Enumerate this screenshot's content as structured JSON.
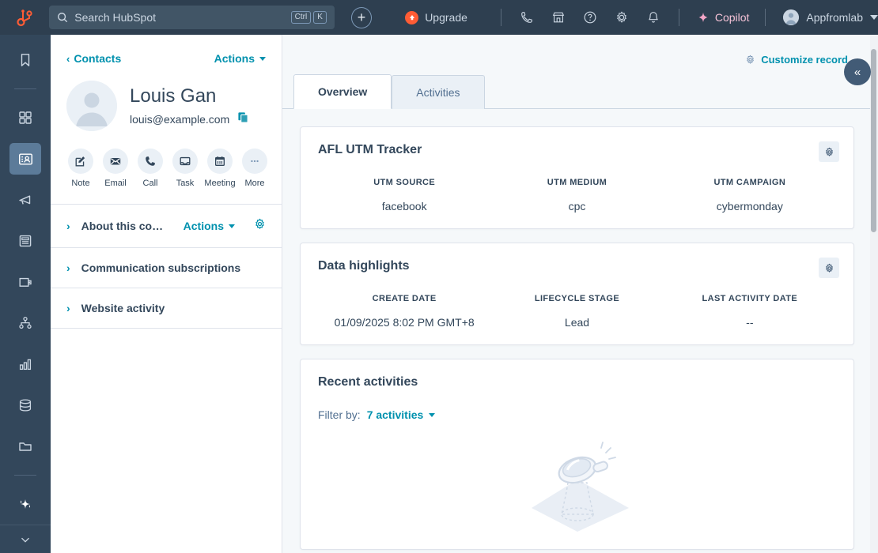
{
  "topnav": {
    "logo_icon": "hubspot-sprocket-logo",
    "search": {
      "placeholder": "Search HubSpot",
      "shortcut_modifier": "Ctrl",
      "shortcut_key": "K",
      "icon": "search-icon"
    },
    "create_button_label": "+",
    "upgrade_label": "Upgrade",
    "icons": [
      "phone-icon",
      "marketplace-icon",
      "help-circle-icon",
      "settings-gear-icon",
      "notifications-bell-icon"
    ],
    "copilot_label": "Copilot",
    "copilot_icon": "sparkle-icon",
    "account_name": "Appfromlab",
    "account_avatar": "user-avatar-icon"
  },
  "rail": {
    "items": [
      {
        "name": "bookmarks",
        "icon": "bookmark-icon",
        "active": false
      },
      {
        "name": "workspaces",
        "icon": "grid-icon",
        "active": false
      },
      {
        "name": "crm-contacts",
        "icon": "contacts-card-icon",
        "active": true
      },
      {
        "name": "marketing",
        "icon": "megaphone-icon",
        "active": false
      },
      {
        "name": "content",
        "icon": "content-page-icon",
        "active": false
      },
      {
        "name": "commerce",
        "icon": "wallet-icon",
        "active": false
      },
      {
        "name": "automation",
        "icon": "workflow-nodes-icon",
        "active": false
      },
      {
        "name": "reporting",
        "icon": "bar-chart-icon",
        "active": false
      },
      {
        "name": "data-management",
        "icon": "database-icon",
        "active": false
      },
      {
        "name": "library",
        "icon": "folder-icon",
        "active": false
      },
      {
        "name": "ai-assistant",
        "icon": "ai-sparkle-icon",
        "active": false
      }
    ],
    "expand_icon": "chevron-down-icon"
  },
  "left_panel": {
    "breadcrumb_label": "Contacts",
    "breadcrumb_icon": "chevron-left-icon",
    "actions_label": "Actions",
    "contact_name": "Louis Gan",
    "contact_email": "louis@example.com",
    "copy_icon": "copy-icon",
    "quick_actions": [
      {
        "label": "Note",
        "icon": "note-pencil-icon"
      },
      {
        "label": "Email",
        "icon": "envelope-icon"
      },
      {
        "label": "Call",
        "icon": "phone-icon"
      },
      {
        "label": "Task",
        "icon": "task-tray-icon"
      },
      {
        "label": "Meeting",
        "icon": "calendar-icon"
      },
      {
        "label": "More",
        "icon": "ellipsis-icon"
      }
    ],
    "sections": [
      {
        "title": "About this co…",
        "has_actions": true,
        "actions_label": "Actions",
        "gear_icon": "gear-icon"
      },
      {
        "title": "Communication subscriptions",
        "has_actions": false
      },
      {
        "title": "Website activity",
        "has_actions": false
      }
    ]
  },
  "main": {
    "customize_label": "Customize record",
    "customize_icon": "gear-icon",
    "collapse_icon": "double-chevron-left-icon",
    "tabs": [
      {
        "label": "Overview",
        "active": true
      },
      {
        "label": "Activities",
        "active": false
      }
    ],
    "cards": [
      {
        "title": "AFL UTM Tracker",
        "gear_icon": "gear-icon",
        "properties": [
          {
            "label": "UTM SOURCE",
            "value": "facebook"
          },
          {
            "label": "UTM MEDIUM",
            "value": "cpc"
          },
          {
            "label": "UTM CAMPAIGN",
            "value": "cybermonday"
          }
        ]
      },
      {
        "title": "Data highlights",
        "gear_icon": "gear-icon",
        "properties": [
          {
            "label": "CREATE DATE",
            "value": "01/09/2025 8:02 PM GMT+8"
          },
          {
            "label": "LIFECYCLE STAGE",
            "value": "Lead"
          },
          {
            "label": "LAST ACTIVITY DATE",
            "value": "--"
          }
        ]
      }
    ],
    "recent_activities": {
      "title": "Recent activities",
      "filter_label": "Filter by:",
      "filter_value": "7 activities",
      "empty_illustration": "magnifying-glass-empty-state-icon"
    }
  },
  "colors": {
    "nav_background": "#2e3f50",
    "rail_background": "#33475b",
    "accent_teal": "#0091ae",
    "text_dark": "#33475b",
    "upgrade_orange": "#ff5c35",
    "page_background": "#f5f8fa"
  }
}
